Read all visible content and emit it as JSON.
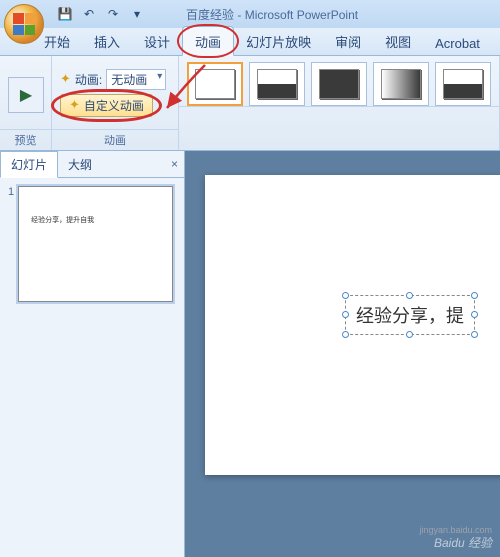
{
  "title": {
    "doc": "百度经验",
    "app": "Microsoft PowerPoint"
  },
  "qat": {
    "save": "💾",
    "undo": "↶",
    "redo": "↷",
    "down": "▾"
  },
  "tabs": {
    "home": "开始",
    "insert": "插入",
    "design": "设计",
    "animation": "动画",
    "slideshow": "幻灯片放映",
    "review": "审阅",
    "view": "视图",
    "acrobat": "Acrobat"
  },
  "ribbon": {
    "preview_label": "预览",
    "preview_icon": "▶",
    "anim_prefix_icon": "✦",
    "anim_label": "动画:",
    "anim_value": "无动画",
    "custom_anim": "自定义动画",
    "anim_group": "动画"
  },
  "sidepanel": {
    "slides_tab": "幻灯片",
    "outline_tab": "大纲",
    "close": "×",
    "thumb_text": "经验分享，提升自我",
    "slide_number": "1"
  },
  "slide": {
    "textbox": "经验分享，提"
  },
  "watermark": {
    "logo": "Baidu 经验",
    "url": "jingyan.baidu.com"
  }
}
